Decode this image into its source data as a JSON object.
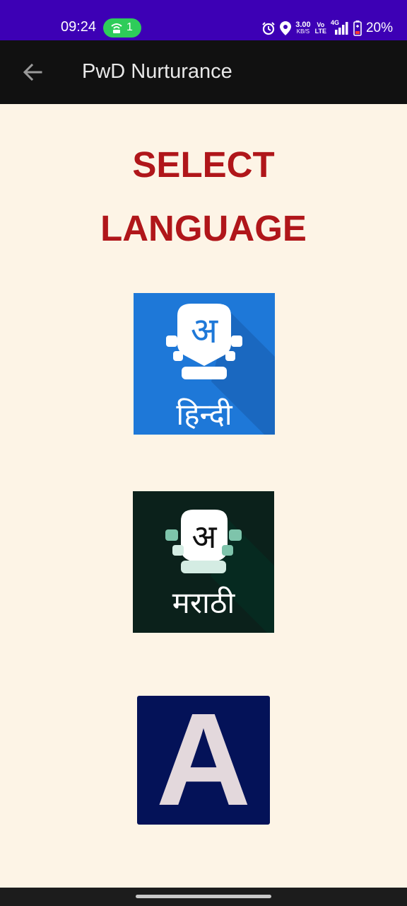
{
  "status_bar": {
    "time": "09:24",
    "hotspot_count": "1",
    "net_speed_value": "3.00",
    "net_speed_unit": "KB/S",
    "volte_top": "Vo",
    "volte_bottom": "LTE",
    "network_type": "4G",
    "battery": "20%",
    "icons": [
      "hotspot-icon",
      "alarm-icon",
      "location-icon",
      "signal-icon",
      "battery-icon"
    ]
  },
  "app_bar": {
    "title": "PwD Nurturance",
    "back_icon": "arrow-back-icon"
  },
  "heading": {
    "line1": "SELECT",
    "line2": "LANGUAGE"
  },
  "languages": [
    {
      "label": "हिन्दी",
      "glyph": "अ",
      "color": "#1e78d8"
    },
    {
      "label": "मराठी",
      "glyph": "अ",
      "color": "#0b211b"
    },
    {
      "glyph": "A",
      "color": "#041258"
    }
  ],
  "colors": {
    "status_bar": "#3d00b5",
    "app_bar": "#111111",
    "background": "#fdf4e6",
    "heading": "#b0161a"
  }
}
